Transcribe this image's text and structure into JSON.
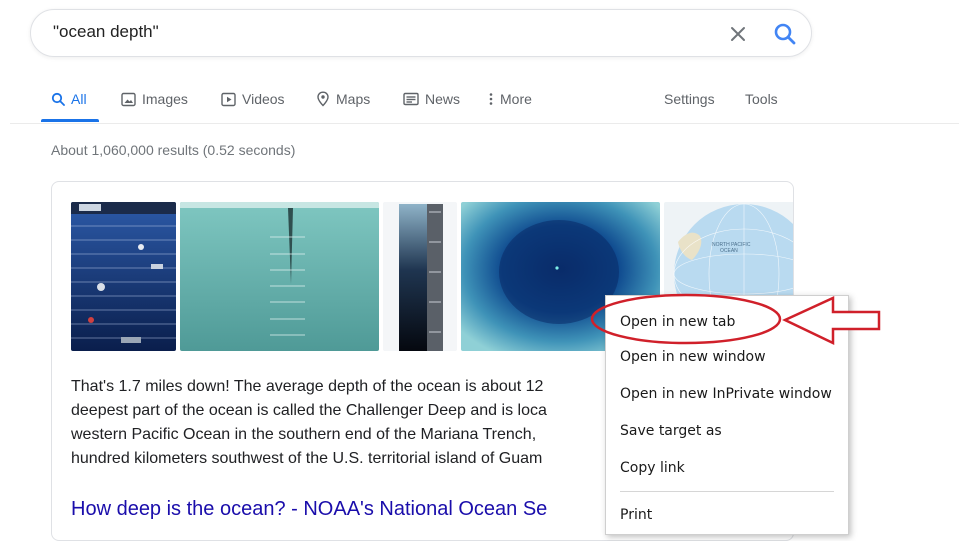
{
  "search": {
    "query": "\"ocean depth\"",
    "clear_icon": "close-icon",
    "search_icon": "search-icon"
  },
  "tabs": [
    {
      "label": "All",
      "icon": "search-icon",
      "active": true
    },
    {
      "label": "Images",
      "icon": "image-icon"
    },
    {
      "label": "Videos",
      "icon": "play-icon"
    },
    {
      "label": "Maps",
      "icon": "map-pin-icon"
    },
    {
      "label": "News",
      "icon": "news-icon"
    },
    {
      "label": "More",
      "icon": "more-vert-icon"
    }
  ],
  "tools": {
    "settings_label": "Settings",
    "tools_label": "Tools"
  },
  "results": {
    "stats": "About 1,060,000 results (0.52 seconds)"
  },
  "snippet": {
    "lines": [
      "That's 1.7 miles down! The average depth of the ocean is about 12",
      "deepest part of the ocean is called the Challenger Deep and is loca",
      "western Pacific Ocean in the southern end of the Mariana Trench,",
      "hundred kilometers southwest of the U.S. territorial island of Guam"
    ],
    "link_text": "How deep is the ocean? - NOAA's National Ocean Se"
  },
  "map_thumbnail": {
    "label_line1": "NORTH PACIFIC",
    "label_line2": "OCEAN"
  },
  "context_menu": {
    "items": [
      "Open in new tab",
      "Open in new window",
      "Open in new InPrivate window",
      "Save target as",
      "Copy link",
      "Print"
    ]
  },
  "annotation": {
    "color": "#d0202a"
  },
  "colors": {
    "accent": "#1a73e8",
    "link": "#1a0dab",
    "text_secondary": "#70757a"
  }
}
